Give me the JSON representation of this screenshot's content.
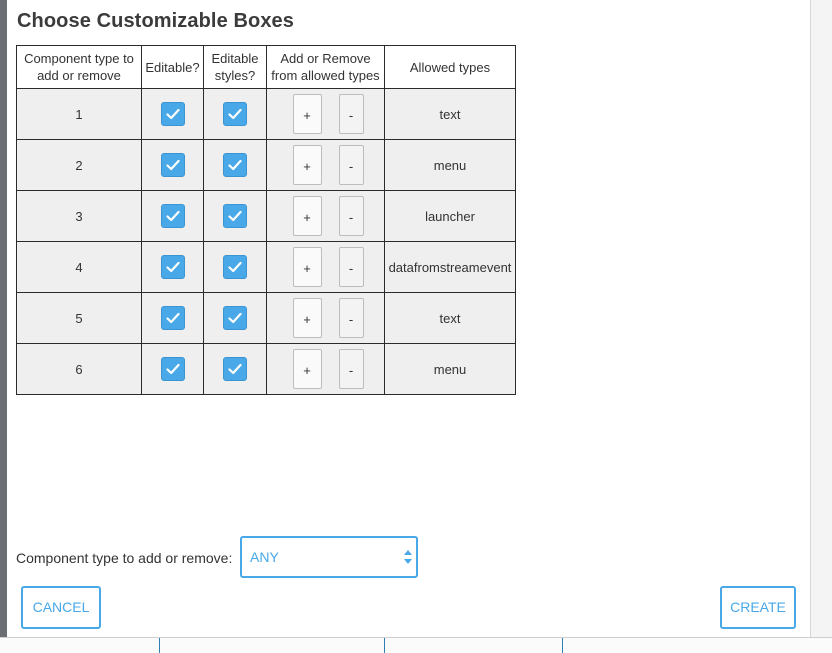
{
  "dialog": {
    "title": "Choose Customizable Boxes",
    "columns": [
      "Component type to add or remove",
      "Editable?",
      "Editable styles?",
      "Add or Remove from allowed types",
      "Allowed types"
    ],
    "rows": [
      {
        "id": "1",
        "editable": true,
        "editable_styles": true,
        "add_label": "+",
        "remove_label": "-",
        "allowed": "text"
      },
      {
        "id": "2",
        "editable": true,
        "editable_styles": true,
        "add_label": "+",
        "remove_label": "-",
        "allowed": "menu"
      },
      {
        "id": "3",
        "editable": true,
        "editable_styles": true,
        "add_label": "+",
        "remove_label": "-",
        "allowed": "launcher"
      },
      {
        "id": "4",
        "editable": true,
        "editable_styles": true,
        "add_label": "+",
        "remove_label": "-",
        "allowed": "datafromstreamevent"
      },
      {
        "id": "5",
        "editable": true,
        "editable_styles": true,
        "add_label": "+",
        "remove_label": "-",
        "allowed": "text"
      },
      {
        "id": "6",
        "editable": true,
        "editable_styles": true,
        "add_label": "+",
        "remove_label": "-",
        "allowed": "menu"
      }
    ],
    "type_label": "Component type to add or remove:",
    "type_select_value": "ANY",
    "cancel_label": "CANCEL",
    "create_label": "CREATE"
  },
  "colors": {
    "accent": "#48a8e8",
    "cell_bg": "#efefef",
    "title_text": "#3b3b3b"
  },
  "icons": {
    "checkbox": "checkmark-icon",
    "select_arrows": "updown-arrows-icon"
  }
}
